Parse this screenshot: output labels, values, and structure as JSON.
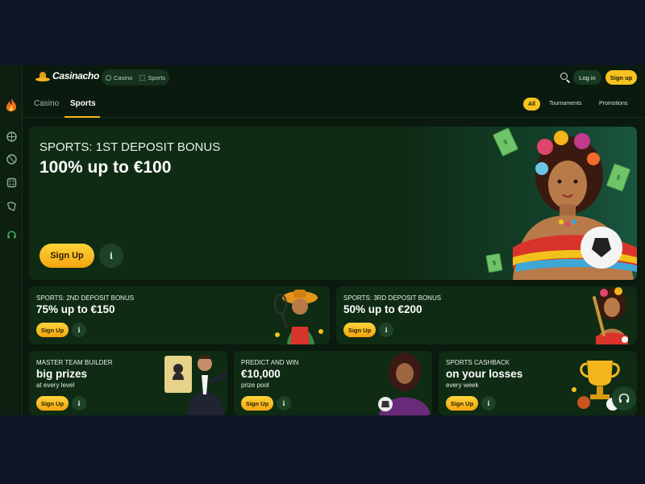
{
  "brand": {
    "name": "Casinacho"
  },
  "topbar": {
    "segments": [
      {
        "label": "Casino",
        "icon": "chip-icon"
      },
      {
        "label": "Sports",
        "icon": "sports-grid-icon"
      }
    ],
    "login_label": "Log in",
    "signup_label": "Sign up"
  },
  "tabs": [
    {
      "label": "Casino",
      "active": false
    },
    {
      "label": "Sports",
      "active": true
    }
  ],
  "filters": [
    {
      "label": "All",
      "active": true
    },
    {
      "label": "Tournaments",
      "active": false
    },
    {
      "label": "Promotions",
      "active": false
    }
  ],
  "hero": {
    "kicker": "SPORTS: 1ST DEPOSIT BONUS",
    "headline": "100% up to €100",
    "cta": "Sign Up",
    "info": "i"
  },
  "promos_row1": [
    {
      "kicker": "SPORTS: 2ND DEPOSIT BONUS",
      "headline": "75% up to €150",
      "cta": "Sign Up",
      "info": "i"
    },
    {
      "kicker": "SPORTS: 3RD DEPOSIT BONUS",
      "headline": "50% up to €200",
      "cta": "Sign Up",
      "info": "i"
    }
  ],
  "promos_row2": [
    {
      "kicker": "MASTER TEAM BUILDER",
      "headline": "big prizes",
      "sub": "at every level",
      "cta": "Sign Up",
      "info": "i"
    },
    {
      "kicker": "PREDICT AND WIN",
      "headline": "€10,000",
      "sub": "prize pool",
      "cta": "Sign Up",
      "info": "i"
    },
    {
      "kicker": "SPORTS CASHBACK",
      "headline": "on your losses",
      "sub": "every week",
      "cta": "Sign Up",
      "info": "i"
    }
  ],
  "colors": {
    "page_bg": "#0f1526",
    "app_bg": "#0b1a0e",
    "card_bg": "#0f2b14",
    "accent_yellow": "#f6c21f"
  },
  "rail_icons": [
    "menu-icon",
    "flame-icon",
    "soccer-icon",
    "basketball-icon",
    "dice-icon",
    "map-icon",
    "support-headset-icon"
  ]
}
